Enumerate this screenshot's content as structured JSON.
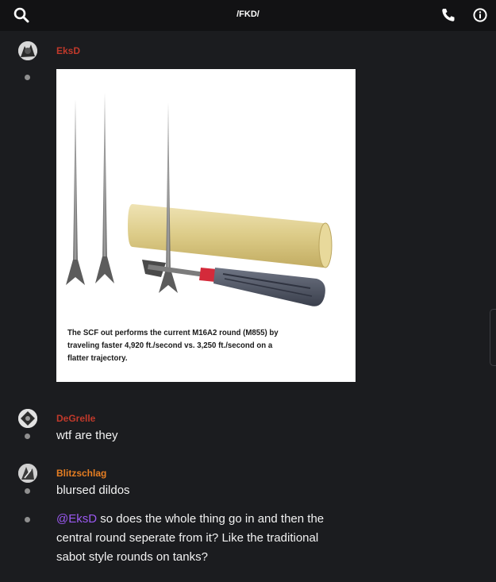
{
  "header": {
    "title": "/FKD/",
    "icons": [
      "search-icon",
      "phone-icon",
      "info-icon"
    ]
  },
  "messages": [
    {
      "username": "EksD",
      "username_color": "#c0392b",
      "attachment": {
        "caption": "The SCF out performs the current M16A2 round (M855) by traveling faster 4,920 ft./second vs. 3,250 ft./second on a flatter trajectory."
      }
    },
    {
      "username": "DeGrelle",
      "username_color": "#c0392b",
      "text": "wtf are they"
    },
    {
      "username": "Blitzschlag",
      "username_color": "#e67e22",
      "text": "blursed dildos",
      "reply": {
        "mention": "@EksD",
        "line1": " so does the whole thing go in and then the",
        "line2": "central round seperate from it?  Like the traditional",
        "line3": "sabot style rounds on tanks?"
      }
    }
  ],
  "colors": {
    "background": "#1b1c1f",
    "topbar": "#121214",
    "mention": "#9b59f2"
  }
}
